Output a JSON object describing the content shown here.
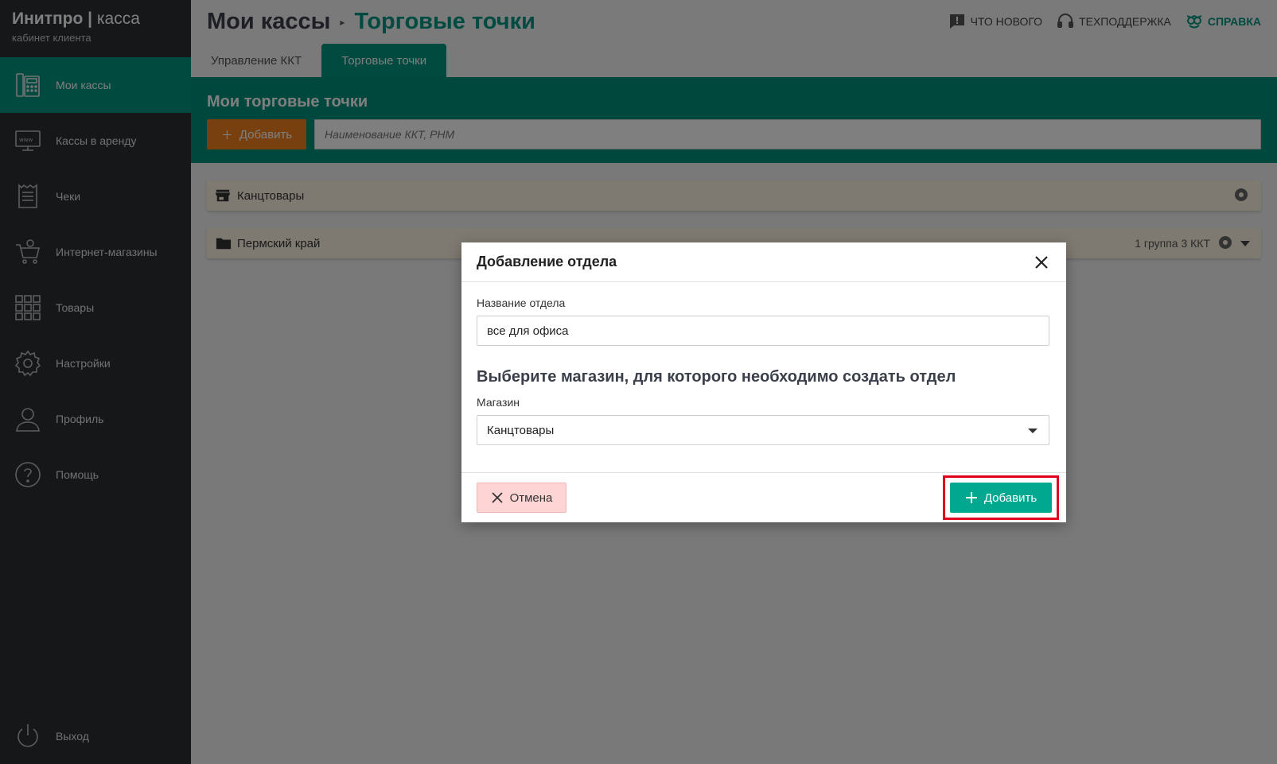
{
  "brand": {
    "title_bold": "Инитпро",
    "title_light": "касса",
    "subtitle": "кабинет клиента"
  },
  "sidebar": {
    "items": [
      {
        "label": "Мои кассы",
        "icon": "cash-register-icon",
        "active": true
      },
      {
        "label": "Кассы в аренду",
        "icon": "www-monitor-icon"
      },
      {
        "label": "Чеки",
        "icon": "receipt-icon"
      },
      {
        "label": "Интернет-магазины",
        "icon": "shopping-cart-icon"
      },
      {
        "label": "Товары",
        "icon": "grid-icon"
      },
      {
        "label": "Настройки",
        "icon": "gear-icon"
      },
      {
        "label": "Профиль",
        "icon": "user-icon"
      },
      {
        "label": "Помощь",
        "icon": "question-icon"
      }
    ],
    "exit_label": "Выход"
  },
  "header": {
    "breadcrumb_root": "Мои кассы",
    "breadcrumb_current": "Торговые точки",
    "links": {
      "whats_new": "ЧТО НОВОГО",
      "support": "ТЕХПОДДЕРЖКА",
      "help": "СПРАВКА"
    }
  },
  "tabs": [
    {
      "label": "Управление ККТ"
    },
    {
      "label": "Торговые точки",
      "active": true
    }
  ],
  "panel": {
    "title": "Мои торговые точки",
    "add_label": "Добавить",
    "search_placeholder": "Наименование ККТ, РНМ"
  },
  "list": {
    "rows": [
      {
        "label": "Канцтовары",
        "icon": "store-icon"
      },
      {
        "label": "Пермский край",
        "icon": "folder-icon",
        "meta": "1 группа 3 ККТ"
      }
    ]
  },
  "modal": {
    "title": "Добавление отдела",
    "name_label": "Название отдела",
    "name_value": "все для офиса",
    "section_title": "Выберите магазин, для которого необходимо создать отдел",
    "shop_label": "Магазин",
    "shop_value": "Канцтовары",
    "cancel_label": "Отмена",
    "add_label": "Добавить"
  },
  "colors": {
    "accent": "#00947f",
    "sidebar": "#2b2e33",
    "orange": "#f0801e",
    "highlight": "#e1001b"
  }
}
